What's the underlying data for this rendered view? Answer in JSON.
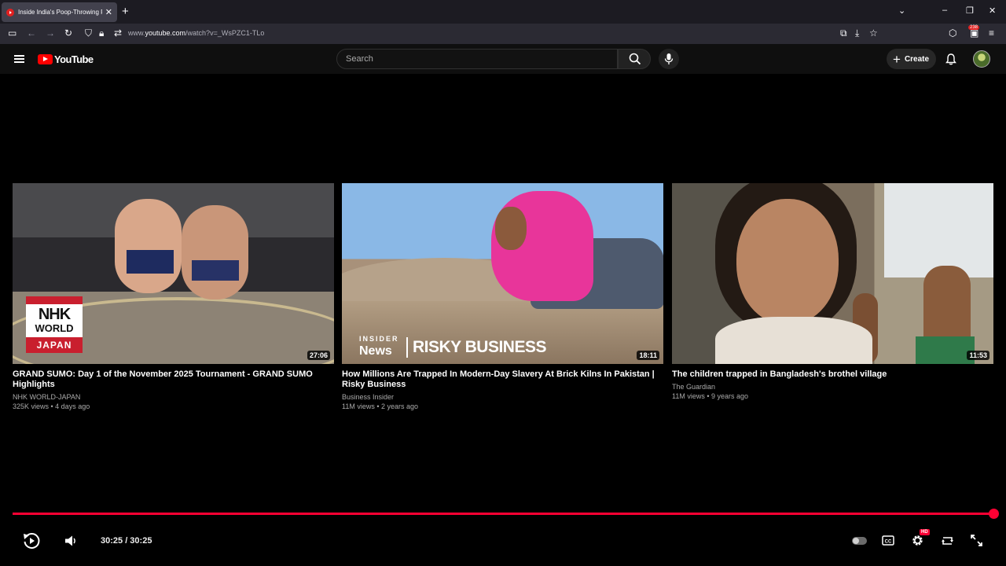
{
  "browser": {
    "tab_title": "Inside India's Poop-Throwing F",
    "new_tab": "+",
    "tab_close": "✕",
    "url_prefix": "www.",
    "url_domain": "youtube.com",
    "url_path": "/watch?v=_WsPZC1-TLo",
    "extension_badge": "238"
  },
  "youtube": {
    "logo_text": "YouTube",
    "search_placeholder": "Search",
    "create_label": "Create"
  },
  "endscreen": {
    "videos": [
      {
        "title": "GRAND SUMO: Day 1 of the November 2025 Tournament - GRAND SUMO Highlights",
        "channel": "NHK WORLD-JAPAN",
        "meta": "325K views • 4 days ago",
        "duration": "27:06",
        "logo_lines": [
          "NHK",
          "WORLD",
          "JAPAN"
        ]
      },
      {
        "title": "How Millions Are Trapped In Modern-Day Slavery At Brick Kilns In Pakistan | Risky Business",
        "channel": "Business Insider",
        "meta": "11M views • 2 years ago",
        "duration": "18:11",
        "overlay_small": "INSIDER",
        "overlay_news": "News",
        "overlay_big": "RISKY BUSINESS"
      },
      {
        "title": "The children trapped in Bangladesh's brothel village",
        "channel": "The Guardian",
        "meta": "11M views • 9 years ago",
        "duration": "11:53"
      }
    ]
  },
  "player": {
    "time": "30:25 / 30:25",
    "progress": 1.0,
    "quality_badge": "HD",
    "accent_color": "#ff0033"
  }
}
